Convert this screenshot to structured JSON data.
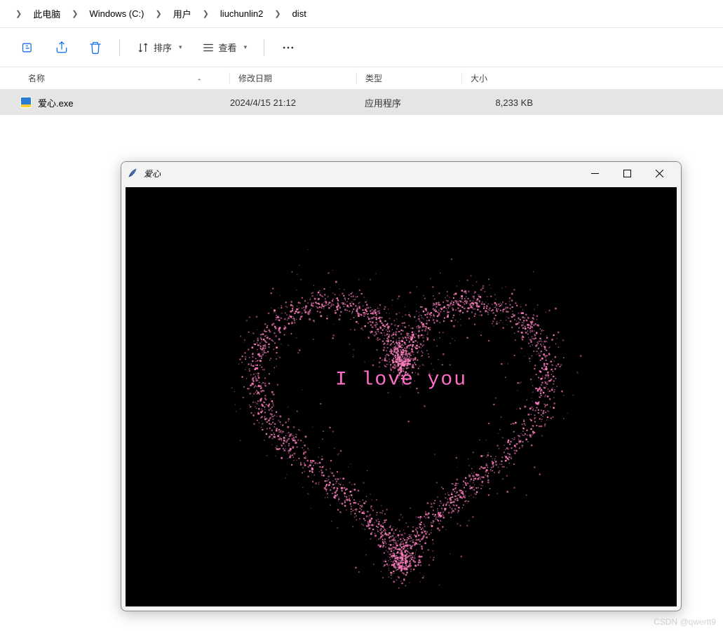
{
  "breadcrumb": {
    "items": [
      "此电脑",
      "Windows (C:)",
      "用户",
      "liuchunlin2",
      "dist"
    ]
  },
  "toolbar": {
    "sort_label": "排序",
    "view_label": "查看"
  },
  "columns": {
    "name": "名称",
    "date": "修改日期",
    "type": "类型",
    "size": "大小"
  },
  "files": [
    {
      "name": "爱心.exe",
      "date": "2024/4/15 21:12",
      "type": "应用程序",
      "size": "8,233 KB"
    }
  ],
  "app_window": {
    "title": "爱心",
    "text": "I love you"
  },
  "colors": {
    "heart": "#ff7fc0",
    "text": "#ff6ec7"
  },
  "watermark": "CSDN @qwertt9"
}
